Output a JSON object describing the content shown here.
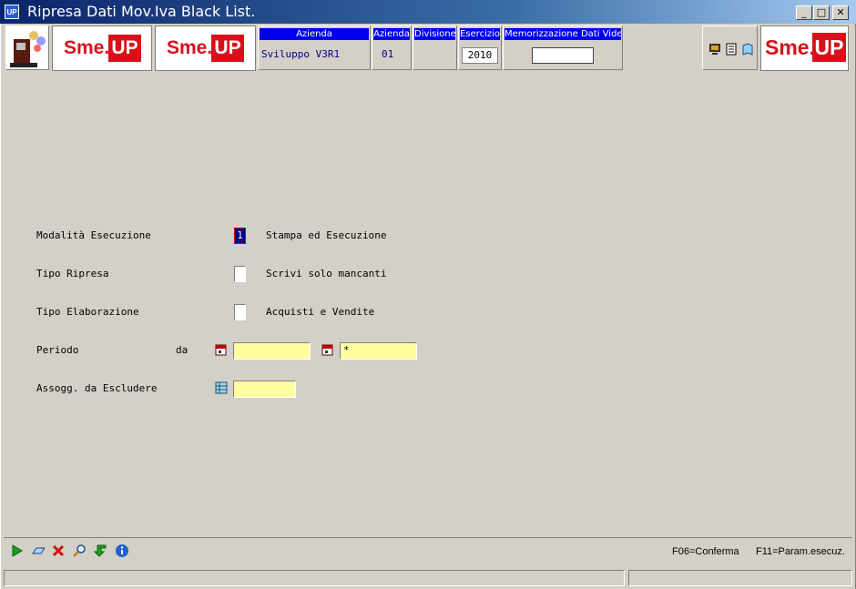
{
  "window": {
    "app_icon_label": "UP",
    "title": "Ripresa Dati Mov.Iva Black List.",
    "min_label": "_",
    "max_label": "□",
    "close_label": "✕"
  },
  "header": {
    "logo_sme": "Sme.",
    "logo_up": "UP",
    "azienda_label": "Azienda",
    "azienda_value": "Sviluppo V3R1",
    "azienda_code_label": "Azienda",
    "azienda_code_value": "01",
    "divisione_label": "Divisione",
    "esercizio_label": "Esercizio",
    "esercizio_value": "2010",
    "memorizzazione_label": "Memorizzazione Dati Video",
    "memorizzazione_value": ""
  },
  "form": {
    "modalita_label": "Modalità Esecuzione",
    "modalita_value": "1",
    "modalita_desc": "Stampa ed Esecuzione",
    "tipo_ripresa_label": "Tipo Ripresa",
    "tipo_ripresa_value": "",
    "tipo_ripresa_desc": "Scrivi solo mancanti",
    "tipo_elab_label": "Tipo Elaborazione",
    "tipo_elab_value": "",
    "tipo_elab_desc": "Acquisti e Vendite",
    "periodo_label": "Periodo",
    "periodo_da_label": "da",
    "periodo_da_value": "",
    "periodo_a_value": "*",
    "assogg_label": "Assogg. da Escludere",
    "assogg_value": ""
  },
  "footer": {
    "f06": "F06=Conferma",
    "f11": "F11=Param.esecuz."
  },
  "colors": {
    "accent_blue": "#0000ee",
    "brand_red": "#d9101a",
    "field_yellow": "#ffffa0"
  }
}
